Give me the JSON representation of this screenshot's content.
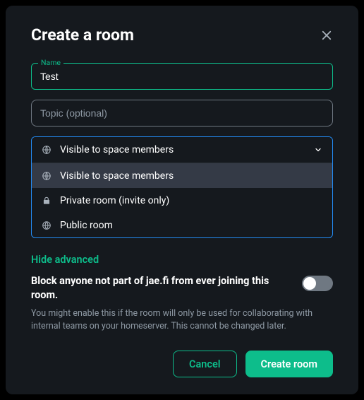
{
  "dialog": {
    "title": "Create a room"
  },
  "name_field": {
    "label": "Name",
    "value": "Test"
  },
  "topic_field": {
    "placeholder": "Topic (optional)",
    "value": ""
  },
  "visibility": {
    "selected": "Visible to space members",
    "options": [
      {
        "label": "Visible to space members",
        "icon": "globe-grid",
        "selected": true
      },
      {
        "label": "Private room (invite only)",
        "icon": "lock",
        "selected": false
      },
      {
        "label": "Public room",
        "icon": "globe",
        "selected": false
      }
    ]
  },
  "advanced": {
    "toggle_label": "Hide advanced",
    "block_title": "Block anyone not part of jae.fi from ever joining this room.",
    "block_hint": "You might enable this if the room will only be used for collaborating with internal teams on your homeserver. This cannot be changed later.",
    "block_enabled": false
  },
  "buttons": {
    "cancel": "Cancel",
    "create": "Create room"
  }
}
